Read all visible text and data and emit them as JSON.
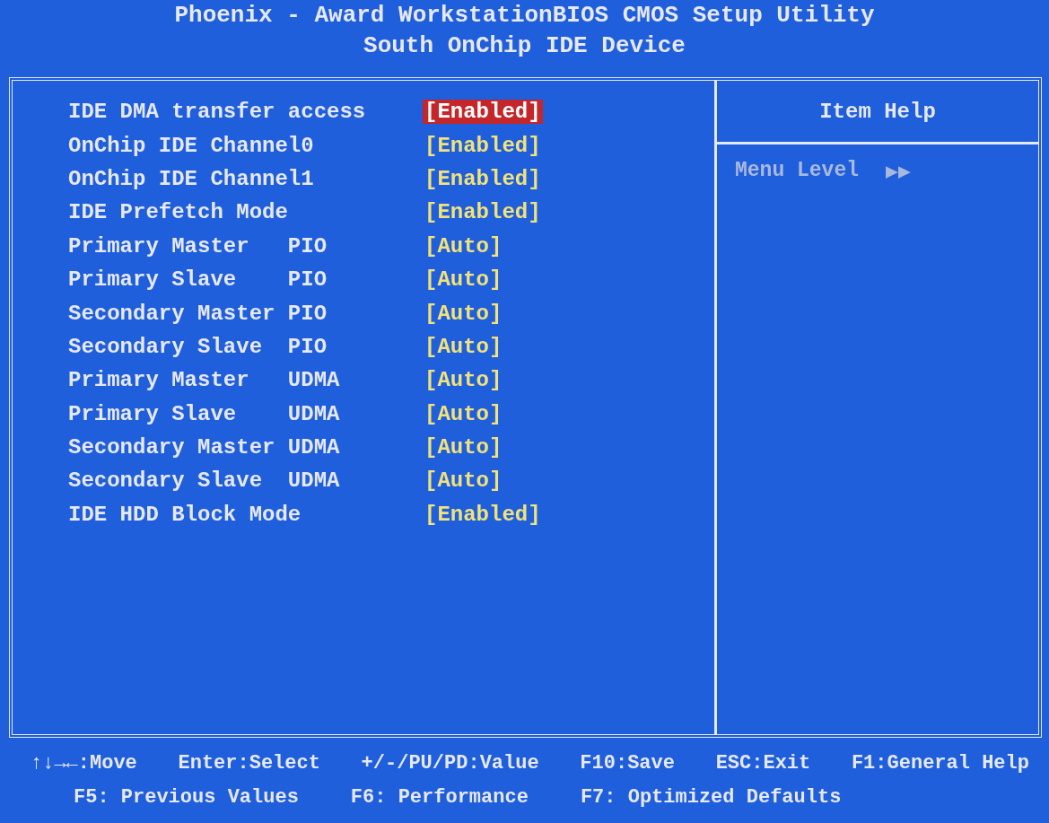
{
  "header": {
    "title": "Phoenix - Award WorkstationBIOS CMOS Setup Utility",
    "subtitle": "South OnChip IDE Device"
  },
  "settings": [
    {
      "label": "IDE DMA transfer access",
      "value": "[Enabled]",
      "selected": true
    },
    {
      "label": "OnChip IDE Channel0",
      "value": "[Enabled]",
      "selected": false
    },
    {
      "label": "OnChip IDE Channel1",
      "value": "[Enabled]",
      "selected": false
    },
    {
      "label": "IDE Prefetch Mode",
      "value": "[Enabled]",
      "selected": false
    },
    {
      "label": "Primary Master   PIO",
      "value": "[Auto]",
      "selected": false
    },
    {
      "label": "Primary Slave    PIO",
      "value": "[Auto]",
      "selected": false
    },
    {
      "label": "Secondary Master PIO",
      "value": "[Auto]",
      "selected": false
    },
    {
      "label": "Secondary Slave  PIO",
      "value": "[Auto]",
      "selected": false
    },
    {
      "label": "Primary Master   UDMA",
      "value": "[Auto]",
      "selected": false
    },
    {
      "label": "Primary Slave    UDMA",
      "value": "[Auto]",
      "selected": false
    },
    {
      "label": "Secondary Master UDMA",
      "value": "[Auto]",
      "selected": false
    },
    {
      "label": "Secondary Slave  UDMA",
      "value": "[Auto]",
      "selected": false
    },
    {
      "label": "IDE HDD Block Mode",
      "value": "[Enabled]",
      "selected": false
    }
  ],
  "help": {
    "title": "Item Help",
    "menu_level_label": "Menu Level",
    "menu_level_marker": "▶▶"
  },
  "footer": [
    [
      "↑↓→←:Move",
      "Enter:Select",
      "+/-/PU/PD:Value",
      "F10:Save",
      "ESC:Exit",
      "F1:General Help"
    ],
    [
      "F5: Previous Values",
      "F6: Performance",
      "F7: Optimized Defaults"
    ]
  ]
}
